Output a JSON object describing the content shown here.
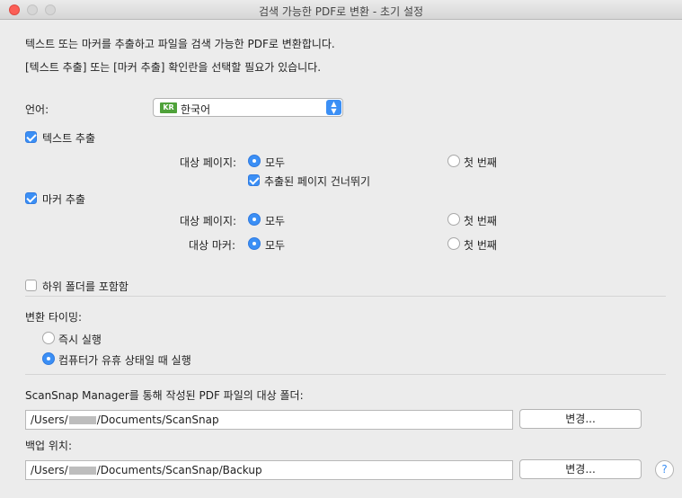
{
  "window": {
    "title": "검색 가능한 PDF로 변환 - 초기 설정"
  },
  "intro": {
    "line1": "텍스트 또는 마커를 추출하고 파일을 검색 가능한 PDF로 변환합니다.",
    "line2": "[텍스트 추출] 또는 [마커 추출] 확인란을 선택할 필요가 있습니다."
  },
  "language": {
    "label": "언어:",
    "flag": "KR",
    "selected": "한국어"
  },
  "text_extract": {
    "label": "텍스트 추출",
    "checked": true,
    "target_pages_label": "대상 페이지:",
    "opt_all": "모두",
    "opt_first": "첫 번째",
    "skip_label": "추출된 페이지 건너뛰기",
    "skip_checked": true
  },
  "marker_extract": {
    "label": "마커 추출",
    "checked": true,
    "target_pages_label": "대상 페이지:",
    "target_markers_label": "대상 마커:",
    "opt_all": "모두",
    "opt_first": "첫 번째"
  },
  "subfolders": {
    "label": "하위 폴더를 포함함",
    "checked": false
  },
  "timing": {
    "label": "변환 타이밍:",
    "opt_now": "즉시 실행",
    "opt_idle": "컴퓨터가 유휴 상태일 때 실행"
  },
  "target_folder": {
    "label": "ScanSnap Manager를 통해 작성된 PDF 파일의 대상 폴더:",
    "path_prefix": "/Users/",
    "path_suffix": "/Documents/ScanSnap",
    "button": "변경..."
  },
  "backup": {
    "label": "백업 위치:",
    "path_prefix": "/Users/",
    "path_suffix": "/Documents/ScanSnap/Backup",
    "button": "변경..."
  },
  "help": "?"
}
